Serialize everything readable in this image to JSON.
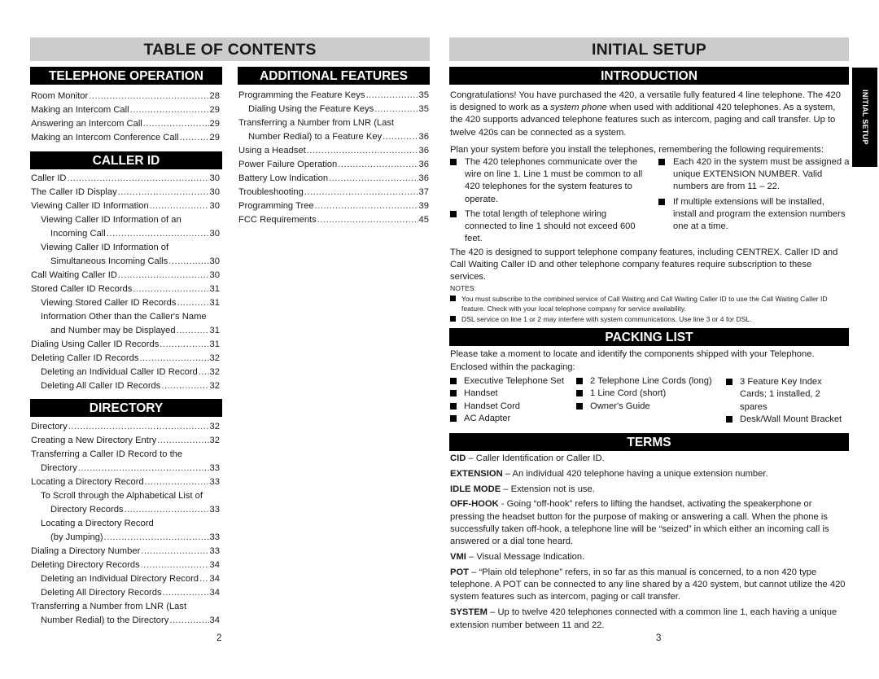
{
  "left_page": {
    "header": "TABLE OF CONTENTS",
    "page_number": "2",
    "sections": {
      "telephone_operation": {
        "title": "TELEPHONE OPERATION",
        "entries": [
          {
            "text": "Room Monitor",
            "page": "28",
            "indent": 0
          },
          {
            "text": "Making an Intercom Call",
            "page": "29",
            "indent": 0
          },
          {
            "text": "Answering an Intercom Call",
            "page": "29",
            "indent": 0
          },
          {
            "text": "Making an Intercom Conference Call",
            "page": "29",
            "indent": 0
          }
        ]
      },
      "caller_id": {
        "title": "CALLER ID",
        "entries": [
          {
            "text": "Caller ID",
            "page": "30",
            "indent": 0
          },
          {
            "text": "The Caller ID Display",
            "page": "30",
            "indent": 0
          },
          {
            "text": "Viewing Caller ID Information",
            "page": "30",
            "indent": 0
          },
          {
            "text": "Viewing Caller ID Information of an",
            "page": "",
            "indent": 1
          },
          {
            "text": "Incoming Call",
            "page": "30",
            "indent": 2
          },
          {
            "text": "Viewing Caller ID Information of",
            "page": "",
            "indent": 1
          },
          {
            "text": "Simultaneous Incoming Calls",
            "page": "30",
            "indent": 2
          },
          {
            "text": "Call Waiting Caller ID",
            "page": "30",
            "indent": 0
          },
          {
            "text": "Stored Caller ID Records",
            "page": "31",
            "indent": 0
          },
          {
            "text": "Viewing Stored Caller ID Records",
            "page": "31",
            "indent": 1
          },
          {
            "text": "Information Other than the Caller's Name",
            "page": "",
            "indent": 1
          },
          {
            "text": "and Number may be Displayed",
            "page": "31",
            "indent": 2
          },
          {
            "text": "Dialing Using Caller ID Records",
            "page": "31",
            "indent": 0
          },
          {
            "text": "Deleting Caller ID Records",
            "page": "32",
            "indent": 0
          },
          {
            "text": "Deleting an Individual Caller ID Record",
            "page": "32",
            "indent": 1
          },
          {
            "text": "Deleting All Caller ID Records",
            "page": "32",
            "indent": 1
          }
        ]
      },
      "directory": {
        "title": "DIRECTORY",
        "entries": [
          {
            "text": "Directory",
            "page": "32",
            "indent": 0
          },
          {
            "text": "Creating a New Directory Entry",
            "page": "32",
            "indent": 0
          },
          {
            "text": "Transferring a Caller ID Record to the",
            "page": "",
            "indent": 0
          },
          {
            "text": "Directory",
            "page": "33",
            "indent": 1
          },
          {
            "text": "Locating a Directory Record",
            "page": "33",
            "indent": 0
          },
          {
            "text": "To Scroll through the Alphabetical List of",
            "page": "",
            "indent": 1
          },
          {
            "text": "Directory Records",
            "page": "33",
            "indent": 2
          },
          {
            "text": "Locating a Directory Record",
            "page": "",
            "indent": 1
          },
          {
            "text": "(by Jumping)",
            "page": "33",
            "indent": 2
          },
          {
            "text": "Dialing a Directory Number",
            "page": "33",
            "indent": 0
          },
          {
            "text": "Deleting Directory Records",
            "page": "34",
            "indent": 0
          },
          {
            "text": "Deleting an Individual Directory Record",
            "page": "34",
            "indent": 1
          },
          {
            "text": "Deleting All Directory Records",
            "page": "34",
            "indent": 1
          },
          {
            "text": "Transferring a Number from LNR (Last",
            "page": "",
            "indent": 0
          },
          {
            "text": "Number Redial) to the Directory",
            "page": "34",
            "indent": 1
          }
        ]
      },
      "additional_features": {
        "title": "ADDITIONAL FEATURES",
        "entries": [
          {
            "text": "Programming the Feature Keys",
            "page": "35",
            "indent": 0
          },
          {
            "text": "Dialing Using the Feature Keys",
            "page": "35",
            "indent": 1
          },
          {
            "text": "Transferring a Number from LNR (Last",
            "page": "",
            "indent": 0
          },
          {
            "text": "Number Redial) to a Feature Key",
            "page": "36",
            "indent": 1
          },
          {
            "text": "Using a Headset",
            "page": "36",
            "indent": 0
          },
          {
            "text": "Power Failure Operation",
            "page": "36",
            "indent": 0
          },
          {
            "text": "Battery Low Indication",
            "page": "36",
            "indent": 0
          },
          {
            "text": "Troubleshooting",
            "page": "37",
            "indent": 0
          },
          {
            "text": "Programming Tree",
            "page": "39",
            "indent": 0
          },
          {
            "text": "FCC Requirements",
            "page": "45",
            "indent": 0
          }
        ]
      }
    }
  },
  "right_page": {
    "header": "INITIAL SETUP",
    "side_tab": "INITIAL SETUP",
    "page_number": "3",
    "introduction": {
      "title": "INTRODUCTION",
      "para1_before": "Congratulations! You have purchased the 420, a versatile fully featured 4 line telephone. The 420 is designed to work as a ",
      "para1_italic": "system phone",
      "para1_after": " when used with additional 420 telephones. As a system, the 420 supports advanced telephone features such as intercom, paging and call transfer. Up to twelve 420s can be connected as a system.",
      "plan_intro": "Plan your system before you install the telephones, remembering the following requirements:",
      "requirements_left": [
        "The 420 telephones communicate over the wire on line 1. Line 1 must be common to all 420 telephones for the system features to operate.",
        "The total length of telephone wiring connected to line 1 should not exceed 600 feet."
      ],
      "requirements_right": [
        "Each 420 in the system must be assigned a unique EXTENSION NUMBER. Valid numbers are from 11 – 22.",
        "If multiple extensions will be installed, install and program the extension numbers one at a time."
      ],
      "para2": "The 420 is designed to support telephone company features, including CENTREX. Caller ID and Call Waiting Caller ID and other telephone company features require subscription to these services.",
      "notes_label": "NOTES:",
      "notes": [
        "You must subscribe to the combined service of Call Waiting and Call Waiting Caller ID to use the Call Waiting Caller ID feature. Check with your local telephone company for service availability.",
        "DSL service on line 1 or 2 may interfere with system communications. Use line 3 or 4 for DSL."
      ]
    },
    "packing_list": {
      "title": "PACKING LIST",
      "intro": "Please take a moment to locate and identify the components shipped with your Telephone.",
      "enclosed": "Enclosed within the packaging:",
      "col1": [
        "Executive Telephone Set",
        "Handset",
        "Handset Cord",
        "AC Adapter"
      ],
      "col2": [
        "2 Telephone Line Cords (long)",
        "1 Line Cord (short)",
        "Owner's Guide"
      ],
      "col3": [
        "3 Feature Key Index Cards; 1 installed, 2 spares",
        "Desk/Wall Mount Bracket"
      ]
    },
    "terms": {
      "title": "TERMS",
      "items": [
        {
          "term": "CID",
          "sep": " – ",
          "definition": "Caller Identification or Caller ID."
        },
        {
          "term": "EXTENSION",
          "sep": " – ",
          "definition": "An individual 420 telephone having a unique extension number."
        },
        {
          "term": "IDLE MODE",
          "sep": " – ",
          "definition": "Extension not is use."
        },
        {
          "term": "OFF-HOOK",
          "sep": " - ",
          "definition": "Going “off-hook” refers to lifting the handset, activating the speakerphone or pressing the headset button for the purpose of making or answering a call. When the phone is successfully taken off-hook, a telephone line will be “seized” in which either an incoming call is answered or a dial tone heard."
        },
        {
          "term": "VMI",
          "sep": " – ",
          "definition": "Visual Message Indication."
        },
        {
          "term": "POT",
          "sep": " – ",
          "definition": "“Plain old telephone” refers, in so far as this manual is concerned, to a non 420 type telephone. A POT can be connected to any line shared by a 420 system, but cannot utilize the 420 system features such as intercom, paging or call transfer."
        },
        {
          "term": "SYSTEM",
          "sep": " – ",
          "definition": "Up to twelve 420 telephones connected with a common line 1, each having a unique extension number between 11 and 22."
        }
      ]
    }
  }
}
